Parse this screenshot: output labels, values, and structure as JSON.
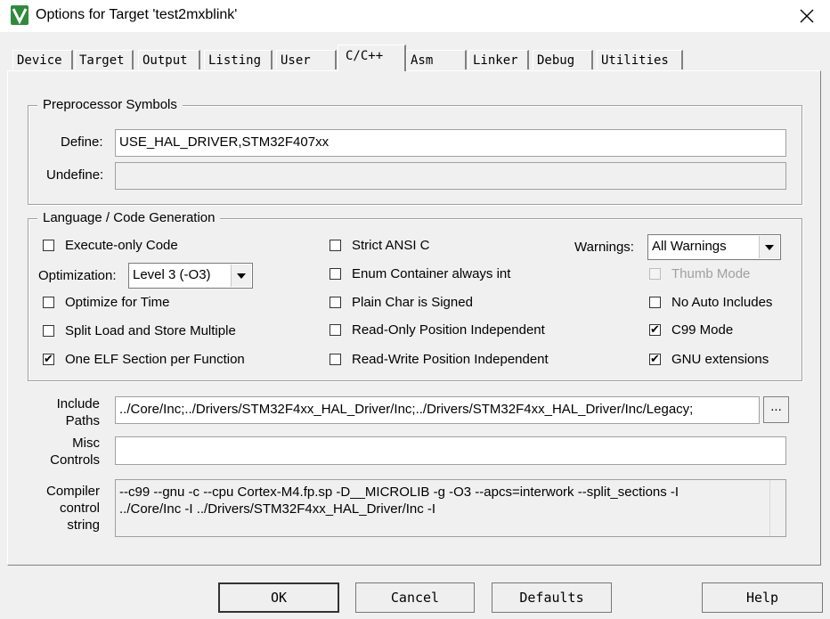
{
  "window": {
    "title": "Options for Target 'test2mxblink'",
    "icon": "keil-uvision-icon",
    "close_icon": "close-icon"
  },
  "tabs": [
    {
      "label": "Device"
    },
    {
      "label": "Target"
    },
    {
      "label": "Output"
    },
    {
      "label": "Listing"
    },
    {
      "label": "User"
    },
    {
      "label": "C/C++",
      "active": true
    },
    {
      "label": "Asm"
    },
    {
      "label": "Linker"
    },
    {
      "label": "Debug"
    },
    {
      "label": "Utilities"
    }
  ],
  "preprocessor": {
    "title": "Preprocessor Symbols",
    "define_label": "Define:",
    "define_value": "USE_HAL_DRIVER,STM32F407xx",
    "undefine_label": "Undefine:",
    "undefine_value": ""
  },
  "language": {
    "title": "Language / Code Generation",
    "execute_only": {
      "label": "Execute-only Code",
      "checked": false
    },
    "optimization_label": "Optimization:",
    "optimization_value": "Level 3 (-O3)",
    "optimize_time": {
      "label": "Optimize for Time",
      "checked": false
    },
    "split_load": {
      "label": "Split Load and Store Multiple",
      "checked": false
    },
    "one_elf": {
      "label": "One ELF Section per Function",
      "checked": true
    },
    "strict_ansi": {
      "label": "Strict ANSI C",
      "checked": false
    },
    "enum_container": {
      "label": "Enum Container always int",
      "checked": false
    },
    "plain_char": {
      "label": "Plain Char is Signed",
      "checked": false
    },
    "ro_pi": {
      "label": "Read-Only Position Independent",
      "checked": false
    },
    "rw_pi": {
      "label": "Read-Write Position Independent",
      "checked": false
    },
    "warnings_label": "Warnings:",
    "warnings_value": "All Warnings",
    "thumb_mode": {
      "label": "Thumb Mode",
      "checked": false,
      "disabled": true
    },
    "no_auto_includes": {
      "label": "No Auto Includes",
      "checked": false
    },
    "c99_mode": {
      "label": "C99 Mode",
      "checked": true
    },
    "gnu_ext": {
      "label": "GNU extensions",
      "checked": true
    }
  },
  "include_paths": {
    "label_line1": "Include",
    "label_line2": "Paths",
    "value": "../Core/Inc;../Drivers/STM32F4xx_HAL_Driver/Inc;../Drivers/STM32F4xx_HAL_Driver/Inc/Legacy;",
    "browse": "..."
  },
  "misc_controls": {
    "label_line1": "Misc",
    "label_line2": "Controls",
    "value": ""
  },
  "compiler_string": {
    "label_line1": "Compiler",
    "label_line2": "control",
    "label_line3": "string",
    "line1": "--c99 --gnu -c --cpu Cortex-M4.fp.sp -D__MICROLIB -g -O3 --apcs=interwork --split_sections -I",
    "line2": "../Core/Inc -I ../Drivers/STM32F4xx_HAL_Driver/Inc -I"
  },
  "buttons": {
    "ok": "OK",
    "cancel": "Cancel",
    "defaults": "Defaults",
    "help": "Help"
  }
}
